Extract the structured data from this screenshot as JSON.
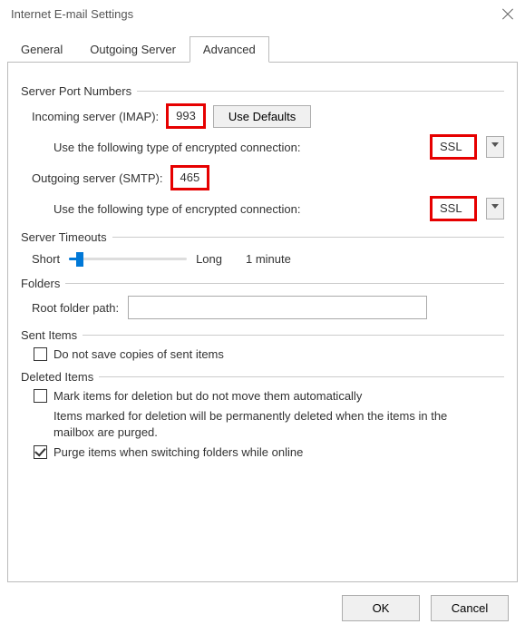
{
  "title": "Internet E-mail Settings",
  "tabs": {
    "general": "General",
    "outgoing": "Outgoing Server",
    "advanced": "Advanced"
  },
  "groups": {
    "ports": "Server Port Numbers",
    "timeouts": "Server Timeouts",
    "folders": "Folders",
    "sent": "Sent Items",
    "deleted": "Deleted Items"
  },
  "ports": {
    "incoming_label": "Incoming server (IMAP):",
    "incoming_value": "993",
    "use_defaults": "Use Defaults",
    "encryption_label": "Use the following type of encrypted connection:",
    "incoming_encryption": "SSL",
    "outgoing_label": "Outgoing server (SMTP):",
    "outgoing_value": "465",
    "outgoing_encryption": "SSL"
  },
  "timeouts": {
    "short": "Short",
    "long": "Long",
    "value": "1 minute"
  },
  "folders": {
    "root_label": "Root folder path:",
    "root_value": ""
  },
  "sent": {
    "dont_save": "Do not save copies of sent items",
    "dont_save_checked": false
  },
  "deleted": {
    "mark_label": "Mark items for deletion but do not move them automatically",
    "mark_checked": false,
    "help_text": "Items marked for deletion will be permanently deleted when the items in the mailbox are purged.",
    "purge_label": "Purge items when switching folders while online",
    "purge_checked": true
  },
  "buttons": {
    "ok": "OK",
    "cancel": "Cancel"
  }
}
